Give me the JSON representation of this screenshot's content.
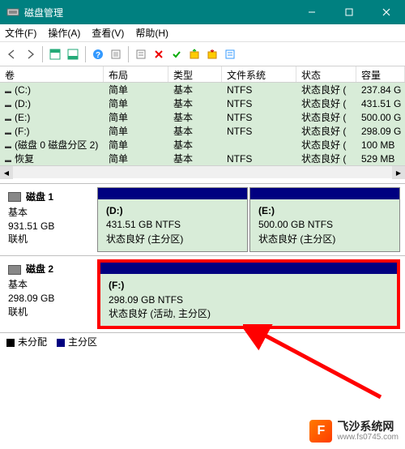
{
  "title": "磁盘管理",
  "menu": {
    "file": "文件(F)",
    "action": "操作(A)",
    "view": "查看(V)",
    "help": "帮助(H)"
  },
  "columns": {
    "vol": "卷",
    "lay": "布局",
    "typ": "类型",
    "fs": "文件系统",
    "st": "状态",
    "cap": "容量"
  },
  "rows": [
    {
      "vol": "(C:)",
      "lay": "简单",
      "typ": "基本",
      "fs": "NTFS",
      "st": "状态良好 (",
      "cap": "237.84 G"
    },
    {
      "vol": "(D:)",
      "lay": "简单",
      "typ": "基本",
      "fs": "NTFS",
      "st": "状态良好 (",
      "cap": "431.51 G"
    },
    {
      "vol": "(E:)",
      "lay": "简单",
      "typ": "基本",
      "fs": "NTFS",
      "st": "状态良好 (",
      "cap": "500.00 G"
    },
    {
      "vol": "(F:)",
      "lay": "简单",
      "typ": "基本",
      "fs": "NTFS",
      "st": "状态良好 (",
      "cap": "298.09 G"
    },
    {
      "vol": "(磁盘 0 磁盘分区 2)",
      "lay": "简单",
      "typ": "基本",
      "fs": "",
      "st": "状态良好 (",
      "cap": "100 MB"
    },
    {
      "vol": "恢复",
      "lay": "简单",
      "typ": "基本",
      "fs": "NTFS",
      "st": "状态良好 (",
      "cap": "529 MB"
    }
  ],
  "disks": [
    {
      "name": "磁盘 1",
      "type": "基本",
      "size": "931.51 GB",
      "status": "联机",
      "parts": [
        {
          "letter": "(D:)",
          "info": "431.51 GB NTFS",
          "status": "状态良好 (主分区)"
        },
        {
          "letter": "(E:)",
          "info": "500.00 GB NTFS",
          "status": "状态良好 (主分区)"
        }
      ],
      "highlight": false
    },
    {
      "name": "磁盘 2",
      "type": "基本",
      "size": "298.09 GB",
      "status": "联机",
      "parts": [
        {
          "letter": "(F:)",
          "info": "298.09 GB NTFS",
          "status": "状态良好 (活动, 主分区)"
        }
      ],
      "highlight": true
    }
  ],
  "legend": {
    "unalloc": "未分配",
    "primary": "主分区"
  },
  "watermark": {
    "brand": "飞沙系统网",
    "url": "www.fs0745.com",
    "logo": "F"
  }
}
